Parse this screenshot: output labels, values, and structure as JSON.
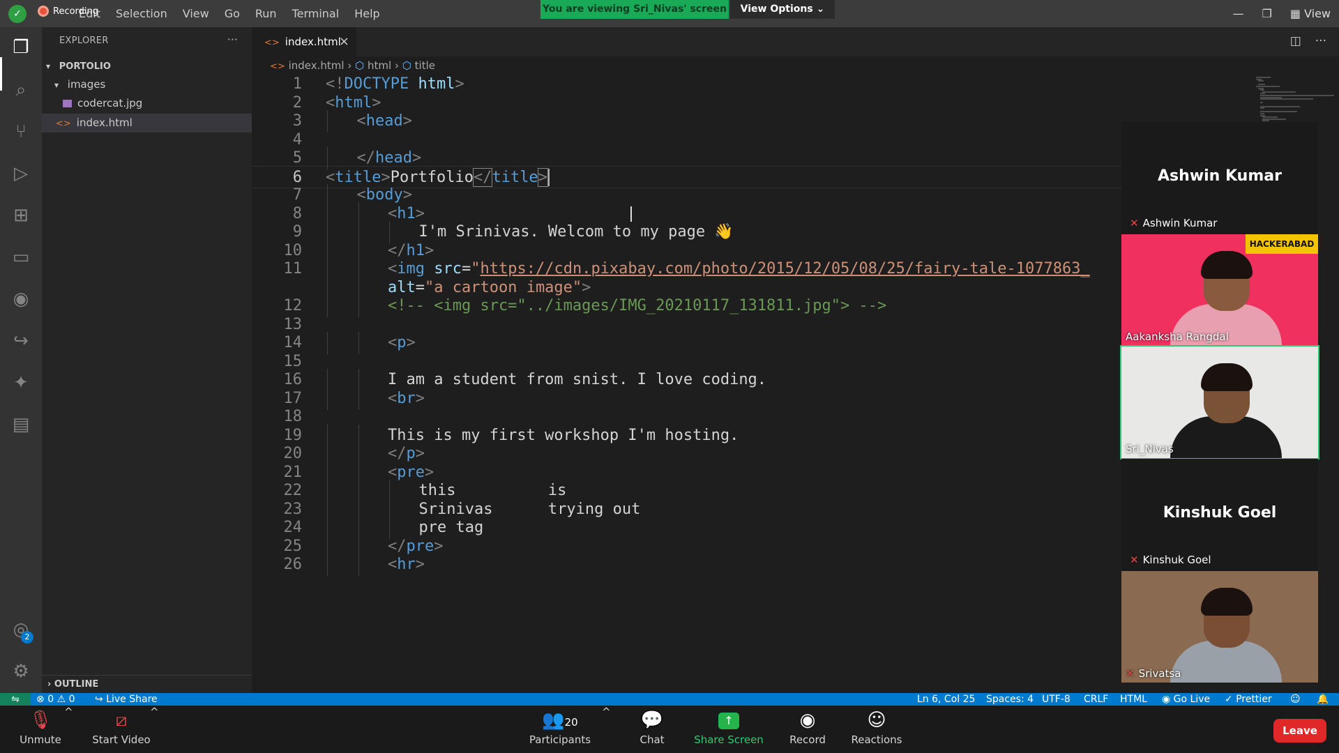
{
  "titlebar": {
    "recording_label": "Recording",
    "menu": [
      "Edit",
      "Selection",
      "View",
      "Go",
      "Run",
      "Terminal",
      "Help"
    ],
    "viewing_banner": "You are viewing Sri_Nivas' screen",
    "view_options": "View Options",
    "view_label": "View"
  },
  "sidebar": {
    "title": "EXPLORER",
    "more": "···",
    "project": "PORTOLIO",
    "folder": "images",
    "files": [
      "codercat.jpg",
      "index.html"
    ],
    "outline": "OUTLINE"
  },
  "editor": {
    "tab": "index.html",
    "breadcrumb": [
      "index.html",
      "html",
      "title"
    ]
  },
  "code_lines": [
    {
      "n": "1",
      "indent": 0,
      "t": [
        [
          "t",
          "<!"
        ],
        [
          "n",
          "DOCTYPE"
        ],
        [
          "d",
          " "
        ],
        [
          "a",
          "html"
        ],
        [
          "t",
          ">"
        ]
      ]
    },
    {
      "n": "2",
      "indent": 0,
      "t": [
        [
          "t",
          "<"
        ],
        [
          "n",
          "html"
        ],
        [
          "t",
          ">"
        ]
      ]
    },
    {
      "n": "3",
      "indent": 1,
      "t": [
        [
          "t",
          "<"
        ],
        [
          "n",
          "head"
        ],
        [
          "t",
          ">"
        ]
      ]
    },
    {
      "n": "4",
      "indent": 0,
      "t": []
    },
    {
      "n": "5",
      "indent": 1,
      "t": [
        [
          "t",
          "</"
        ],
        [
          "n",
          "head"
        ],
        [
          "t",
          ">"
        ]
      ]
    },
    {
      "n": "6",
      "indent": 0,
      "cur": true,
      "t": [
        [
          "t",
          "<"
        ],
        [
          "n",
          "title"
        ],
        [
          "t",
          ">"
        ],
        [
          "d",
          "Portfolio"
        ],
        [
          "th",
          "</"
        ],
        [
          "n",
          "title"
        ],
        [
          "th",
          ">"
        ]
      ]
    },
    {
      "n": "7",
      "indent": 1,
      "t": [
        [
          "t",
          "<"
        ],
        [
          "n",
          "body"
        ],
        [
          "t",
          ">"
        ]
      ]
    },
    {
      "n": "8",
      "indent": 2,
      "t": [
        [
          "t",
          "<"
        ],
        [
          "n",
          "h1"
        ],
        [
          "t",
          ">"
        ]
      ]
    },
    {
      "n": "9",
      "indent": 3,
      "t": [
        [
          "d",
          "I'm Srinivas. Welcom to my page 👋"
        ]
      ]
    },
    {
      "n": "10",
      "indent": 2,
      "t": [
        [
          "t",
          "</"
        ],
        [
          "n",
          "h1"
        ],
        [
          "t",
          ">"
        ]
      ]
    },
    {
      "n": "11",
      "indent": 2,
      "t": [
        [
          "t",
          "<"
        ],
        [
          "n",
          "img"
        ],
        [
          "d",
          " "
        ],
        [
          "a",
          "src"
        ],
        [
          "d",
          "="
        ],
        [
          "s",
          "\""
        ],
        [
          "u",
          "https://cdn.pixabay.com/photo/2015/12/05/08/25/fairy-tale-1077863_"
        ]
      ]
    },
    {
      "n": "",
      "indent": 2,
      "t": [
        [
          "a",
          "alt"
        ],
        [
          "d",
          "="
        ],
        [
          "s",
          "\"a cartoon image\""
        ],
        [
          "t",
          ">"
        ]
      ]
    },
    {
      "n": "12",
      "indent": 2,
      "t": [
        [
          "c",
          "<!-- <img src=\"../images/IMG_20210117_131811.jpg\"> -->"
        ]
      ]
    },
    {
      "n": "13",
      "indent": 0,
      "t": []
    },
    {
      "n": "14",
      "indent": 2,
      "t": [
        [
          "t",
          "<"
        ],
        [
          "n",
          "p"
        ],
        [
          "t",
          ">"
        ]
      ]
    },
    {
      "n": "15",
      "indent": 0,
      "t": []
    },
    {
      "n": "16",
      "indent": 2,
      "t": [
        [
          "d",
          "I am a student from snist. I love coding."
        ]
      ]
    },
    {
      "n": "17",
      "indent": 2,
      "t": [
        [
          "t",
          "<"
        ],
        [
          "n",
          "br"
        ],
        [
          "t",
          ">"
        ]
      ]
    },
    {
      "n": "18",
      "indent": 0,
      "t": []
    },
    {
      "n": "19",
      "indent": 2,
      "t": [
        [
          "d",
          "This is my first workshop I'm hosting."
        ]
      ]
    },
    {
      "n": "20",
      "indent": 2,
      "t": [
        [
          "t",
          "</"
        ],
        [
          "n",
          "p"
        ],
        [
          "t",
          ">"
        ]
      ]
    },
    {
      "n": "21",
      "indent": 2,
      "t": [
        [
          "t",
          "<"
        ],
        [
          "n",
          "pre"
        ],
        [
          "t",
          ">"
        ]
      ]
    },
    {
      "n": "22",
      "indent": 3,
      "t": [
        [
          "d",
          "this          is"
        ]
      ]
    },
    {
      "n": "23",
      "indent": 3,
      "t": [
        [
          "d",
          "Srinivas      trying out"
        ]
      ]
    },
    {
      "n": "24",
      "indent": 3,
      "t": [
        [
          "d",
          "pre tag"
        ]
      ]
    },
    {
      "n": "25",
      "indent": 2,
      "t": [
        [
          "t",
          "</"
        ],
        [
          "n",
          "pre"
        ],
        [
          "t",
          ">"
        ]
      ]
    },
    {
      "n": "26",
      "indent": 2,
      "t": [
        [
          "t",
          "<"
        ],
        [
          "n",
          "hr"
        ],
        [
          "t",
          ">"
        ]
      ]
    }
  ],
  "participants": {
    "tiles": [
      {
        "kind": "name",
        "big": "Ashwin Kumar",
        "small": "Ashwin Kumar",
        "muted": true
      },
      {
        "kind": "video",
        "label": "Aakanksha Rangdal",
        "muted": false,
        "bg": "#f0305f",
        "shirt": "#e8a0b0",
        "skin": "#8a5a3e",
        "banner": "HACKERABAD"
      },
      {
        "kind": "video",
        "label": "Sri_Nivas",
        "muted": false,
        "bg": "#e8e8e6",
        "shirt": "#1a1a1a",
        "skin": "#7a5236",
        "active": true
      },
      {
        "kind": "name",
        "big": "Kinshuk Goel",
        "small": "Kinshuk Goel",
        "muted": true
      },
      {
        "kind": "video",
        "label": "Srivatsa",
        "muted": true,
        "bg": "#8a6a50",
        "shirt": "#9aa0a8",
        "skin": "#7a4e34"
      }
    ]
  },
  "statusbar": {
    "errors": "0",
    "warnings": "0",
    "live_share": "Live Share",
    "position": "Ln 6, Col 25",
    "spaces": "Spaces: 4",
    "encoding": "UTF-8",
    "eol": "CRLF",
    "language": "HTML",
    "go_live": "Go Live",
    "prettier": "Prettier"
  },
  "zoom": {
    "unmute": "Unmute",
    "start_video": "Start Video",
    "participants": "Participants",
    "participant_count": "20",
    "chat": "Chat",
    "share": "Share Screen",
    "record": "Record",
    "reactions": "Reactions",
    "leave": "Leave"
  }
}
